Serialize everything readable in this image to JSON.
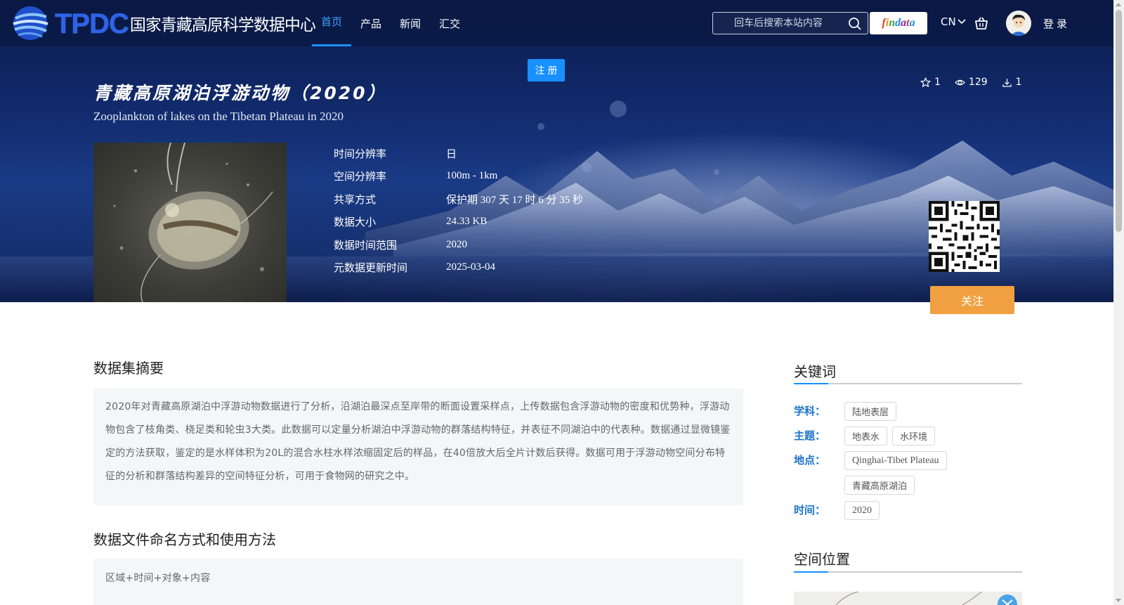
{
  "nav": {
    "logo_text": "TPDC",
    "logo_cn": "国家青藏高原科学数据中心",
    "links": [
      "首页",
      "产品",
      "新闻",
      "汇交"
    ],
    "active_index": 0,
    "search_placeholder": "回车后搜索本站内容",
    "findata_label": "findata",
    "language": "CN",
    "login_label": "登录"
  },
  "register_label": "注册",
  "dataset": {
    "title_cn": "青藏高原湖泊浮游动物（2020）",
    "title_en": "Zooplankton of lakes on the Tibetan Plateau in 2020",
    "stats": {
      "favorites": "1",
      "views": "129",
      "downloads": "1"
    },
    "meta": [
      {
        "key": "时间分辨率",
        "value": "日"
      },
      {
        "key": "空间分辨率",
        "value": "100m - 1km"
      },
      {
        "key": "共享方式",
        "value": "保护期 307 天 17 时 6 分 35 秒"
      },
      {
        "key": "数据大小",
        "value": "24.33 KB"
      },
      {
        "key": "数据时间范围",
        "value": "2020"
      },
      {
        "key": "元数据更新时间",
        "value": "2025-03-04"
      }
    ],
    "follow_label": "关注"
  },
  "abstract": {
    "title": "数据集摘要",
    "text": "2020年对青藏高原湖泊中浮游动物数据进行了分析，沿湖泊最深点至岸带的断面设置采样点，上传数据包含浮游动物的密度和优势种，浮游动物包含了枝角类、桡足类和轮虫3大类。此数据可以定量分析湖泊中浮游动物的群落结构特征，并表征不同湖泊中的代表种。数据通过显微镜鉴定的方法获取，鉴定的是水样体积为20L的混合水柱水样浓缩固定后的样品，在40倍放大后全片计数后获得。数据可用于浮游动物空间分布特征的分析和群落结构差异的空间特征分析，可用于食物网的研究之中。"
  },
  "naming": {
    "title": "数据文件命名方式和使用方法",
    "text": "区域+时间+对象+内容"
  },
  "keywords": {
    "title": "关键词",
    "subject_label": "学科：",
    "subject_tags": [
      "陆地表层"
    ],
    "theme_label": "主题：",
    "theme_tags": [
      "地表水",
      "水环境"
    ],
    "place_label": "地点：",
    "place_tags": [
      "Qinghai-Tibet Plateau",
      "青藏高原湖泊"
    ],
    "time_label": "时间：",
    "time_tags": [
      "2020"
    ]
  },
  "location": {
    "title": "空间位置"
  },
  "icons": {
    "search": "search-icon",
    "cart": "shopping-basket-icon",
    "star": "star-icon",
    "eye": "eye-icon",
    "download": "download-icon"
  },
  "colors": {
    "accent": "#1890ff",
    "follow": "#f0a040",
    "keyword_label": "#1a73c9"
  }
}
